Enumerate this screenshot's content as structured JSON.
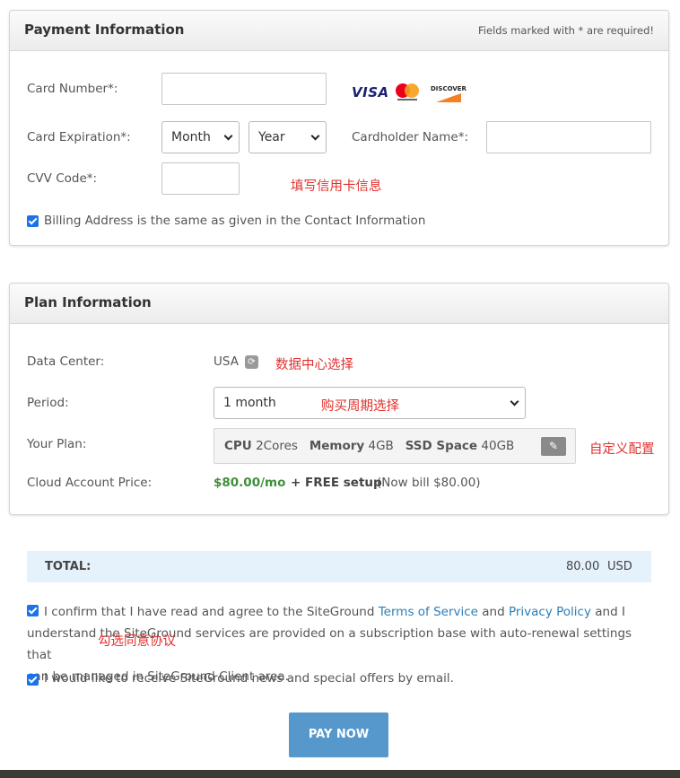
{
  "payment": {
    "title": "Payment Information",
    "required_note": "Fields marked with * are required!",
    "card_number_label": "Card Number*:",
    "card_brands": {
      "visa": "VISA",
      "discover": "DISCOVER"
    },
    "card_expiration_label": "Card Expiration*:",
    "month_value": "Month",
    "year_value": "Year",
    "cardholder_label": "Cardholder Name*:",
    "cvv_label": "CVV Code*:",
    "annotation": "填写信用卡信息",
    "billing_same_label": "Billing Address is the same as given in the Contact Information",
    "billing_same_checked": true
  },
  "plan": {
    "title": "Plan Information",
    "data_center_label": "Data Center:",
    "data_center_value": "USA",
    "data_center_annotation": "数据中心选择",
    "period_label": "Period:",
    "period_value": "1 month",
    "period_annotation": "购买周期选择",
    "your_plan_label": "Your Plan:",
    "cpu_label": "CPU",
    "cpu_value": "2Cores",
    "memory_label": "Memory",
    "memory_value": "4GB",
    "ssd_label": "SSD Space",
    "ssd_value": "40GB",
    "plan_annotation": "自定义配置",
    "price_label": "Cloud Account Price:",
    "price_value": "$80.00/mo",
    "setup_text": "+ FREE setup",
    "bill_note": "(Now bill $80.00)",
    "price_color": "#3f8f3a"
  },
  "total": {
    "label": "TOTAL:",
    "amount": "80.00",
    "currency": "USD"
  },
  "agreement": {
    "tos_prefix": "I confirm that I have read and agree to the SiteGround",
    "tos_link": "Terms of Service",
    "and": "and",
    "privacy_link": "Privacy Policy",
    "and_i": "and I",
    "line2": "understand the SiteGround services are provided on a subscription base with auto-renewal settings that",
    "line3": "can be managed in SiteGround Client area.",
    "annotation": "勾选同意协议",
    "tos_checked": true,
    "news_label": "I would like to receive SiteGround news and special offers by email.",
    "news_checked": true
  },
  "pay_button": "PAY NOW",
  "colors": {
    "accent_blue": "#5698cb",
    "checkbox_blue": "#1a73e8",
    "link_blue": "#2a7fb8",
    "annotation_red": "#e0312e",
    "total_bg": "#e5f1fb"
  }
}
